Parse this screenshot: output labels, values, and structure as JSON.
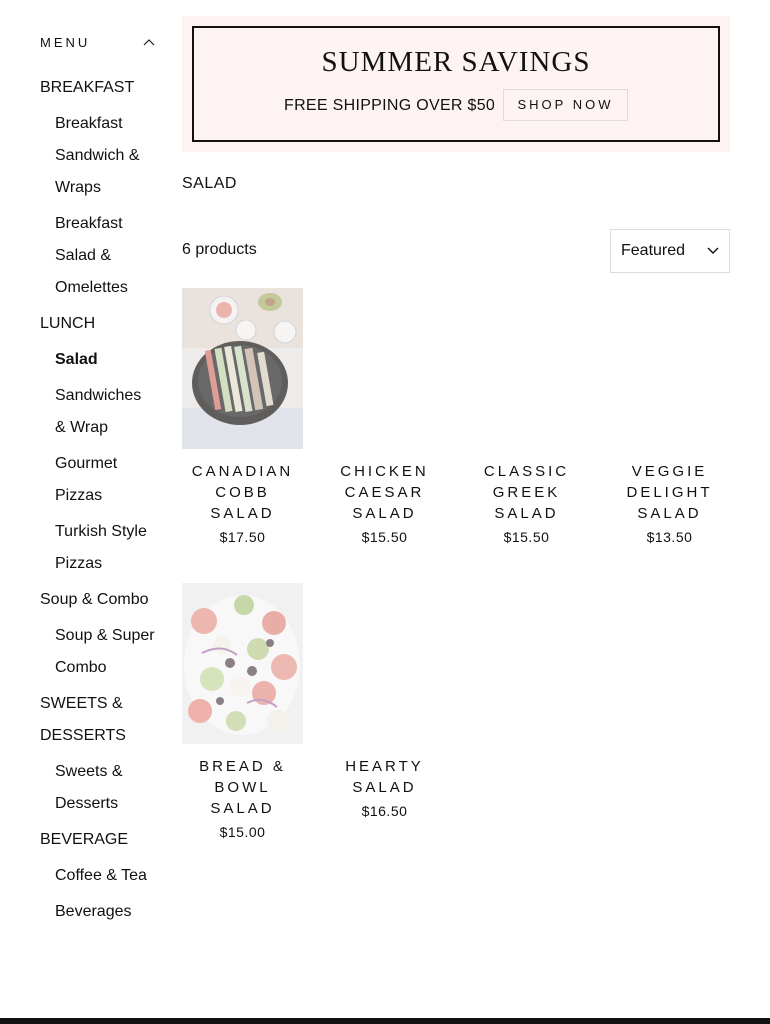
{
  "sidebar": {
    "menu_label": "MENU",
    "items": [
      {
        "label": "BREAKFAST",
        "level": "top"
      },
      {
        "label": "Breakfast Sandwich & Wraps",
        "level": "sub"
      },
      {
        "label": "Breakfast Salad & Omelettes",
        "level": "sub"
      },
      {
        "label": "LUNCH",
        "level": "top"
      },
      {
        "label": "Salad",
        "level": "sub",
        "active": true
      },
      {
        "label": "Sandwiches & Wrap",
        "level": "sub"
      },
      {
        "label": "Gourmet Pizzas",
        "level": "sub"
      },
      {
        "label": "Turkish Style Pizzas",
        "level": "sub"
      },
      {
        "label": "Soup & Combo",
        "level": "top"
      },
      {
        "label": "Soup & Super Combo",
        "level": "sub"
      },
      {
        "label": "SWEETS & DESSERTS",
        "level": "top"
      },
      {
        "label": "Sweets & Desserts",
        "level": "sub"
      },
      {
        "label": "BEVERAGE",
        "level": "top"
      },
      {
        "label": "Coffee & Tea",
        "level": "sub"
      },
      {
        "label": "Beverages",
        "level": "sub"
      }
    ]
  },
  "banner": {
    "title": "SUMMER SAVINGS",
    "subtitle": "FREE SHIPPING OVER $50",
    "button_label": "SHOP NOW",
    "background_color": "#fdf3f2"
  },
  "collection": {
    "title": "SALAD",
    "count_text": "6 products",
    "sort_value": "Featured"
  },
  "products": [
    {
      "name": "CANADIAN COBB SALAD",
      "price": "$17.50",
      "image": "cobb-salad-photo"
    },
    {
      "name": "CHICKEN CAESAR SALAD",
      "price": "$15.50",
      "image": ""
    },
    {
      "name": "CLASSIC GREEK SALAD",
      "price": "$15.50",
      "image": ""
    },
    {
      "name": "VEGGIE DELIGHT SALAD",
      "price": "$13.50",
      "image": ""
    },
    {
      "name": "BREAD & BOWL SALAD",
      "price": "$15.00",
      "image": "bread-bowl-salad-photo"
    },
    {
      "name": "HEARTY SALAD",
      "price": "$16.50",
      "image": ""
    }
  ]
}
